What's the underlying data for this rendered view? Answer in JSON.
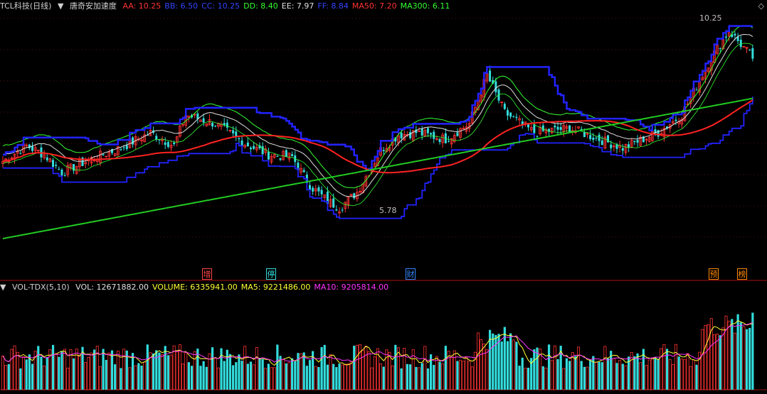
{
  "header": {
    "stock_label": "TCL科技(日线)",
    "indicator_name": "唐奇安加速度",
    "params": [
      {
        "label": "AA: 10.25",
        "color": "#ff3333"
      },
      {
        "label": "BB: 6.50",
        "color": "#3344ff"
      },
      {
        "label": "CC: 10.25",
        "color": "#3344ff"
      },
      {
        "label": "DD: 8.40",
        "color": "#33ff33"
      },
      {
        "label": "EE: 7.97",
        "color": "#e0e0e0"
      },
      {
        "label": "FF: 8.84",
        "color": "#3344ff"
      },
      {
        "label": "MA50: 7.20",
        "color": "#ff3333"
      },
      {
        "label": "MA300: 6.11",
        "color": "#33ff33"
      }
    ],
    "corner_icon": "diamond-icon"
  },
  "vol_header": {
    "name": "VOL-TDX(5,10)",
    "params": [
      {
        "label": "VOL: 12671882.00",
        "color": "#e0e0e0"
      },
      {
        "label": "VOLUME: 6335941.00",
        "color": "#ffff33"
      },
      {
        "label": "MA5: 9221486.00",
        "color": "#ffff33"
      },
      {
        "label": "MA10: 9205814.00",
        "color": "#ff33ff"
      }
    ]
  },
  "event_tags": [
    {
      "label": "增",
      "color": "#ff4444"
    },
    {
      "label": "停",
      "color": "#33dddd"
    },
    {
      "label": "财",
      "color": "#3388ff"
    },
    {
      "label": "预",
      "color": "#ff8800"
    },
    {
      "label": "榜",
      "color": "#ff8800"
    }
  ],
  "chart_data": {
    "type": "candlestick",
    "high_annotation": "10.25",
    "low_annotation": "5.78",
    "price_high": 10.25,
    "price_low": 5.78,
    "colors": {
      "up": "#ff3333",
      "down": "#33dddd",
      "upper_band": "#2222ff",
      "ma50": "#ff2222",
      "ma300": "#22cc22"
    },
    "volume_summary": {
      "last_volume": 12671882,
      "ma5": 9221486,
      "ma10": 9205814
    }
  }
}
